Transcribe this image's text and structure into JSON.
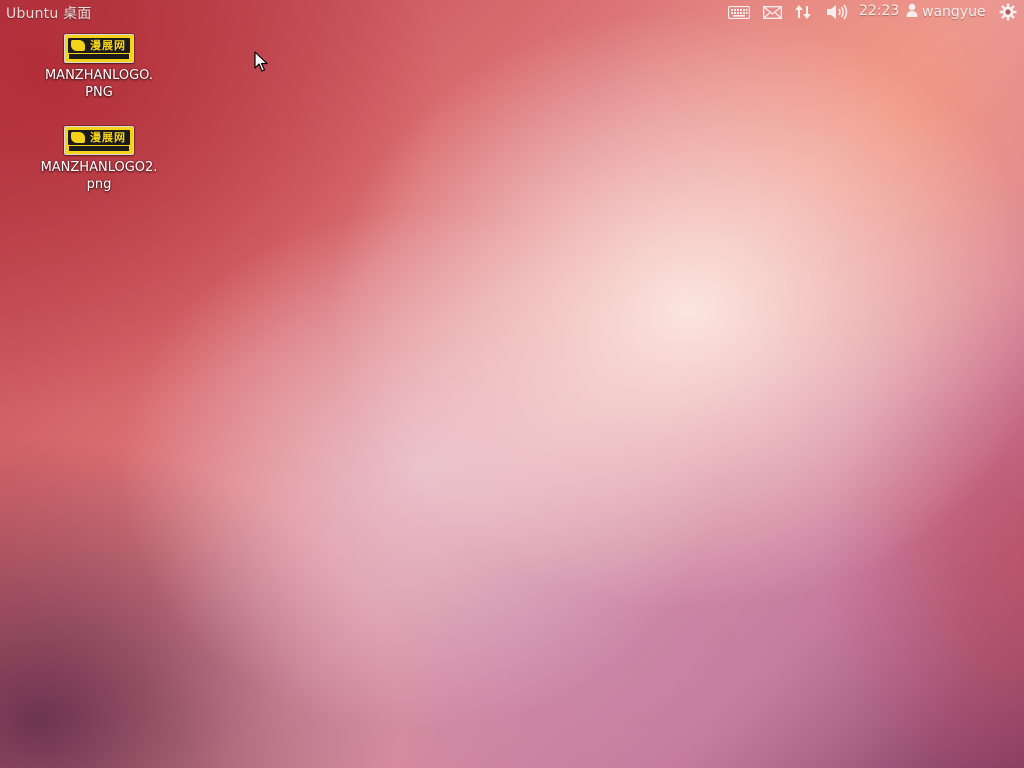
{
  "top_panel": {
    "title": "Ubuntu 桌面",
    "indicators": {
      "keyboard": "keyboard-icon",
      "messaging": "envelope-icon",
      "network": "network-arrows-icon",
      "sound": "speaker-icon"
    },
    "clock": "22:23",
    "user_icon": "user-icon",
    "user_name": "wangyue",
    "session_icon": "gear-icon"
  },
  "desktop": {
    "icons": [
      {
        "line1": "MANZHANLOGO.",
        "line2": "PNG",
        "image": "manzhan-logo-thumbnail",
        "logo_text": "漫展网"
      },
      {
        "line1": "MANZHANLOGO2.",
        "line2": "png",
        "image": "manzhan-logo-thumbnail",
        "logo_text": "漫展网"
      }
    ]
  },
  "colors": {
    "wallpaper_base": "#d86a6e",
    "wallpaper_highlight": "#fde8e2",
    "logo_yellow": "#f6d21a",
    "logo_black": "#1b1b1b",
    "panel_text": "#f4eeee"
  }
}
